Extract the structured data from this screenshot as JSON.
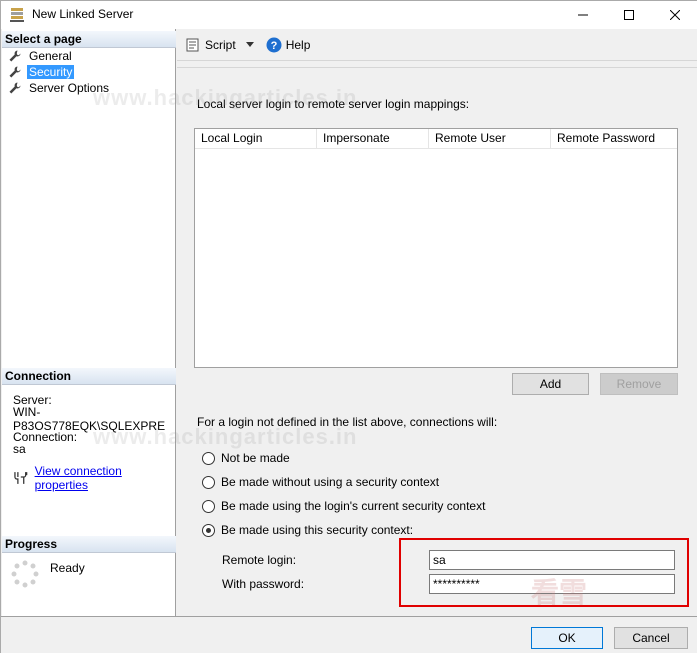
{
  "window": {
    "title": "New Linked Server",
    "minimize_icon": "minimize-icon",
    "maximize_icon": "maximize-icon",
    "close_icon": "close-icon"
  },
  "left_pane": {
    "select_page_header": "Select a page",
    "pages": [
      {
        "label": "General",
        "icon": "wrench-icon",
        "selected": false
      },
      {
        "label": "Security",
        "icon": "wrench-icon",
        "selected": true
      },
      {
        "label": "Server Options",
        "icon": "wrench-icon",
        "selected": false
      }
    ],
    "connection_header": "Connection",
    "server_label": "Server:",
    "server_value": "WIN-P83OS778EQK\\SQLEXPRE",
    "connection_label": "Connection:",
    "connection_value": "sa",
    "view_connection_link": "View connection properties",
    "progress_header": "Progress",
    "progress_status": "Ready"
  },
  "toolbar": {
    "script_label": "Script",
    "help_label": "Help"
  },
  "security": {
    "mapping_label": "Local server login to remote server login mappings:",
    "columns": [
      "Local Login",
      "Impersonate",
      "Remote User",
      "Remote Password"
    ],
    "add_label": "Add",
    "remove_label": "Remove",
    "for_login_label": "For a login not defined in the list above, connections will:",
    "options": [
      {
        "label": "Not be made",
        "checked": false
      },
      {
        "label": "Be made without using a security context",
        "checked": false
      },
      {
        "label": "Be made using the login's current security context",
        "checked": false
      },
      {
        "label": "Be made using this security context:",
        "checked": true
      }
    ],
    "remote_login_label": "Remote login:",
    "remote_login_value": "sa",
    "password_label": "With password:",
    "password_value": "**********"
  },
  "watermark": {
    "text": "www.hackingarticles.in",
    "logo_text": "看雪"
  },
  "footer": {
    "ok_label": "OK",
    "cancel_label": "Cancel"
  },
  "colors": {
    "selection": "#3399ff",
    "highlight_box": "#e00000",
    "link": "#0000ee"
  }
}
